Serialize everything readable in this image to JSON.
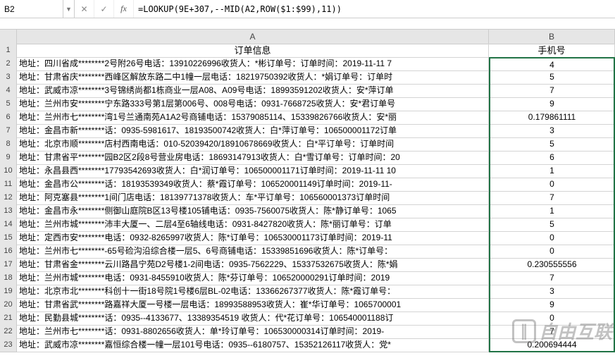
{
  "formula_bar": {
    "name_box": "B2",
    "cancel_glyph": "✕",
    "confirm_glyph": "✓",
    "fx_glyph": "fx",
    "formula": "=LOOKUP(9E+307,--MID(A2,ROW($1:$99),11))"
  },
  "columns": {
    "select_all": "",
    "A": "A",
    "B": "B"
  },
  "header_row": {
    "A": "订单信息",
    "B": "手机号"
  },
  "rows": [
    {
      "n": "2",
      "A": "地址：四川省成********2号附26号电话：13910226996收货人：*彬订单号：订单时间：2019-11-11 7",
      "B": "4"
    },
    {
      "n": "3",
      "A": "地址：甘肃省庆********西峰区解放东路二中1幢一层电话：18219750392收货人：*娟订单号：订单时",
      "B": "5"
    },
    {
      "n": "4",
      "A": "地址：武威市凉********3号锦绣尚都1栋商业一层A08、A09号电话：18993591202收货人：安*萍订单",
      "B": "7"
    },
    {
      "n": "5",
      "A": "地址：兰州市安********宁东路333号第1层第006号、008号电话：0931-7668725收货人：安*君订单号",
      "B": "9"
    },
    {
      "n": "6",
      "A": "地址：兰州市七********湾1号兰通南苑A1A2号商铺电话：15379085114、15339826766收货人：安*丽",
      "B": "0.179861111"
    },
    {
      "n": "7",
      "A": "地址：金昌市新********话：0935-5981617、18193500742收货人：白*萍订单号：106500001172订单",
      "B": "3"
    },
    {
      "n": "8",
      "A": "地址：北京市顺********店村西南电话：010-52039420/18910678669收货人：白*平订单号：订单时间",
      "B": "5"
    },
    {
      "n": "9",
      "A": "地址：甘肃省平********园B2区2段8号营业房电话：18693147913收货人：白*雪订单号：订单时间：20",
      "B": "6"
    },
    {
      "n": "10",
      "A": "地址：永昌县西********17793542693收货人：白*润订单号：106500001171订单时间：2019-11-11 10",
      "B": "1"
    },
    {
      "n": "11",
      "A": "地址：金昌市公********话：18193539349收货人：蔡*霞订单号：106520001149订单时间：2019-11-",
      "B": "0"
    },
    {
      "n": "12",
      "A": "地址：阿克塞县********1间门店电话：18139771378收货人：车*平订单号：106560001373订单时间",
      "B": "7"
    },
    {
      "n": "13",
      "A": "地址：金昌市永********侧御山庭院B区13号楼105铺电话：0935-7560075收货人：陈*静订单号：1065",
      "B": "1"
    },
    {
      "n": "14",
      "A": "地址：兰州市城********沛丰大厦一、二层4至6轴线电话：0931-8427820收货人：陈*丽订单号：订单",
      "B": "5"
    },
    {
      "n": "15",
      "A": "地址：定西市安********电话：0932-8265997收货人：陈*订单号：106530001173订单时间：2019-11",
      "B": "0"
    },
    {
      "n": "16",
      "A": "地址：兰州市七********-65号硷沟沿综合楼一层5、6号商铺电话：15339851696收货人：陈*订单号：",
      "B": "0"
    },
    {
      "n": "17",
      "A": "地址：甘肃省金********云川路昌宁苑D2号楼1-2间电话：0935-7562229、15337532675收货人：陈*娟",
      "B": "0.230555556"
    },
    {
      "n": "18",
      "A": "地址：兰州市城********电话：0931-8455910收货人：陈*芬订单号：106520000291订单时间：2019",
      "B": "7"
    },
    {
      "n": "19",
      "A": "地址：北京市北********科创十一街18号院1号楼6层BL-02电话：13366267377收货人：陈*霞订单号：",
      "B": "3"
    },
    {
      "n": "20",
      "A": "地址：甘肃省武********路嘉祥大厦一号楼一层电话：18993588953收货人：崔*华订单号：1065700001",
      "B": "9"
    },
    {
      "n": "21",
      "A": "地址：民勤县城********话：0935--4133677、13389354519 收货人：代*花订单号：106540001188订",
      "B": "0"
    },
    {
      "n": "22",
      "A": "地址：兰州市七********话：0931-8802656收货人：单*玲订单号：106530000314订单时间：2019-",
      "B": "7"
    },
    {
      "n": "23",
      "A": "地址：武威市凉********嘉恒综合楼一幢一层101号电话：0935--6180757、15352126117收货人：党*",
      "B": "0.200694444"
    }
  ],
  "watermark": {
    "logo_text": "∥",
    "text": "自由互联"
  }
}
